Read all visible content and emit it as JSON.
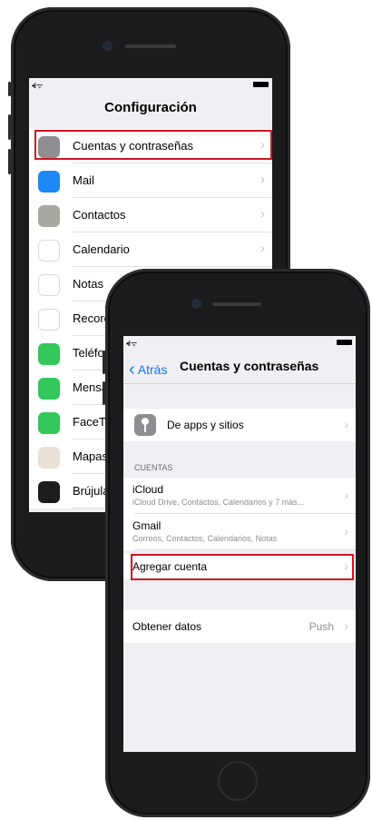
{
  "back_phone": {
    "title": "Configuración",
    "signal": "•ıl ᯤ",
    "items": [
      {
        "label": "Cuentas y contraseñas",
        "icon": "key-icon",
        "color": "#8e8e93"
      },
      {
        "label": "Mail",
        "icon": "mail-icon",
        "color": "#1e88f5"
      },
      {
        "label": "Contactos",
        "icon": "contacts-icon",
        "color": "#a8a8a2"
      },
      {
        "label": "Calendario",
        "icon": "calendar-icon",
        "color": "#ffffff"
      },
      {
        "label": "Notas",
        "icon": "notes-icon",
        "color": "#ffffff"
      },
      {
        "label": "Recordatorios",
        "icon": "reminders-icon",
        "color": "#ffffff"
      },
      {
        "label": "Teléfono",
        "icon": "phone-icon",
        "color": "#34c759"
      },
      {
        "label": "Mensajes",
        "icon": "messages-icon",
        "color": "#34c759"
      },
      {
        "label": "FaceTime",
        "icon": "facetime-icon",
        "color": "#34c759"
      },
      {
        "label": "Mapas",
        "icon": "maps-icon",
        "color": "#e8e2d6"
      },
      {
        "label": "Brújula",
        "icon": "compass-icon",
        "color": "#1c1c1e"
      }
    ]
  },
  "front_phone": {
    "signal": "•ıl ᯤ",
    "back_label": "Atrás",
    "title": "Cuentas y contraseñas",
    "apps_row": "De apps y sitios",
    "section_header": "CUENTAS",
    "accounts": [
      {
        "name": "iCloud",
        "detail": "iCloud Drive, Contactos, Calendarios y 7 más..."
      },
      {
        "name": "Gmail",
        "detail": "Correos, Contactos, Calendarios, Notas"
      }
    ],
    "add_account": "Agregar cuenta",
    "fetch_label": "Obtener datos",
    "fetch_value": "Push"
  },
  "colors": {
    "accent": "#1478f5",
    "highlight": "#d0161e"
  }
}
